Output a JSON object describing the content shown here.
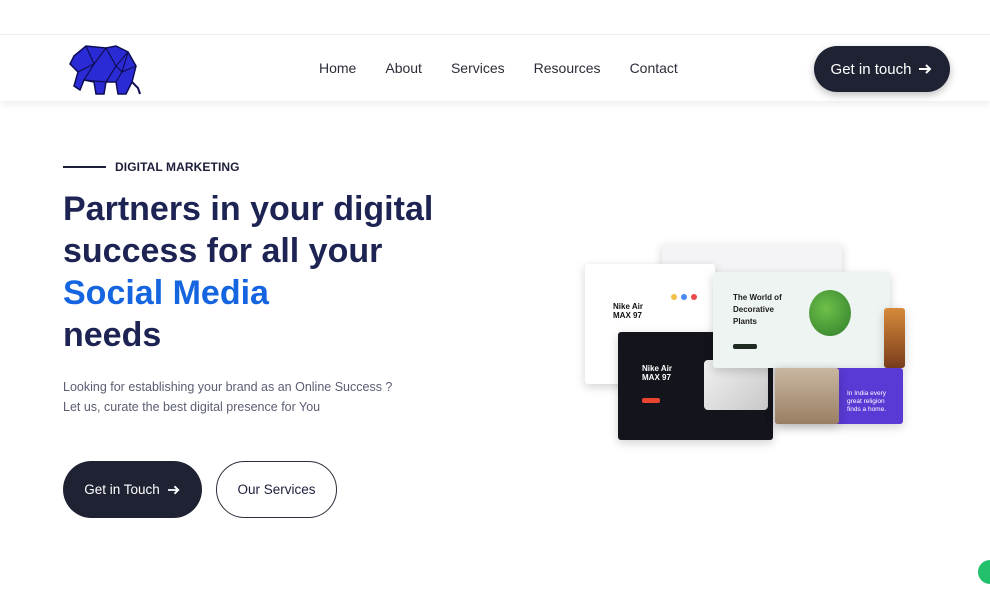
{
  "header": {
    "logo_alt": "elephant-logo",
    "nav": [
      "Home",
      "About",
      "Services",
      "Resources",
      "Contact"
    ],
    "cta_label": "Get in touch"
  },
  "hero": {
    "eyebrow": "DIGITAL MARKETING",
    "headline": {
      "line1": "Partners in your digital",
      "line2": "success for all your",
      "highlight": "Social Media",
      "line4": "needs"
    },
    "subtext": {
      "line1": "Looking for establishing your brand as an Online Success ?",
      "line2": "Let us, curate the best digital presence for You"
    },
    "primary_button": "Get in Touch",
    "secondary_button": "Our Services"
  },
  "collage": {
    "product_title_1": "Nike Air",
    "product_title_2": "MAX 97",
    "plants_title_1": "The World of",
    "plants_title_2": "Decorative",
    "plants_title_3": "Plants",
    "india_text_1": "In India every",
    "india_text_2": "great religion",
    "india_text_3": "finds a home."
  },
  "colors": {
    "primary_dark": "#1f2233",
    "headline": "#1d2352",
    "accent_blue": "#1565e0",
    "logo_blue": "#2b2bd6"
  }
}
